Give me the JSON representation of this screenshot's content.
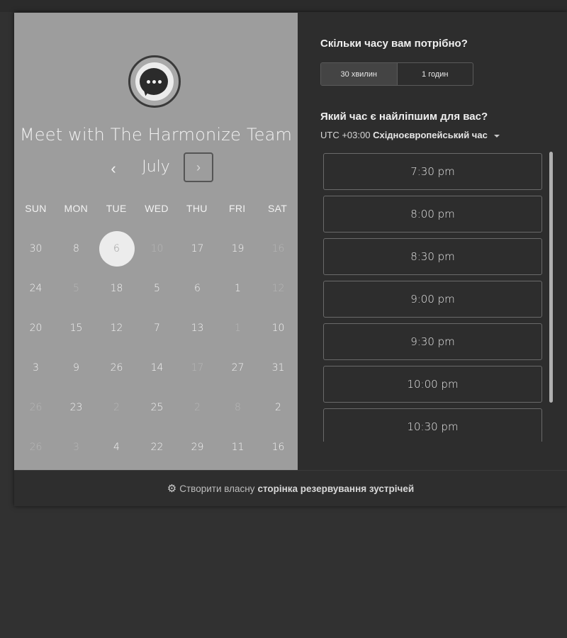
{
  "meeting": {
    "title": "Meet with The Harmonize Team",
    "logo_icon": "chat-bubble-icon"
  },
  "calendar": {
    "month": "July",
    "prev_icon": "‹",
    "next_icon": "›",
    "weekdays": [
      "SUN",
      "MON",
      "TUE",
      "WED",
      "THU",
      "FRI",
      "SAT"
    ],
    "rows": [
      [
        {
          "d": "30"
        },
        {
          "d": "8"
        },
        {
          "d": "6",
          "selected": true
        },
        {
          "d": "10",
          "dim": true
        },
        {
          "d": "17"
        },
        {
          "d": "19"
        },
        {
          "d": "16",
          "dim": true
        }
      ],
      [
        {
          "d": "24"
        },
        {
          "d": "5",
          "dim": true
        },
        {
          "d": "18"
        },
        {
          "d": "5"
        },
        {
          "d": "6"
        },
        {
          "d": "1"
        },
        {
          "d": "12",
          "dim": true
        }
      ],
      [
        {
          "d": "20"
        },
        {
          "d": "15"
        },
        {
          "d": "12"
        },
        {
          "d": "7"
        },
        {
          "d": "13"
        },
        {
          "d": "1",
          "dim": true
        },
        {
          "d": "10"
        }
      ],
      [
        {
          "d": "3"
        },
        {
          "d": "9"
        },
        {
          "d": "26"
        },
        {
          "d": "14"
        },
        {
          "d": "17",
          "dim": true
        },
        {
          "d": "27"
        },
        {
          "d": "31"
        }
      ],
      [
        {
          "d": "26",
          "dim": true
        },
        {
          "d": "23"
        },
        {
          "d": "2",
          "dim": true
        },
        {
          "d": "25"
        },
        {
          "d": "2",
          "dim": true
        },
        {
          "d": "8",
          "dim": true
        },
        {
          "d": "2"
        }
      ],
      [
        {
          "d": "26",
          "dim": true
        },
        {
          "d": "3",
          "dim": true
        },
        {
          "d": "4"
        },
        {
          "d": "22"
        },
        {
          "d": "29"
        },
        {
          "d": "11"
        },
        {
          "d": "16"
        }
      ]
    ]
  },
  "duration": {
    "question": "Скільки часу вам потрібно?",
    "options": [
      "30 хвилин",
      "1 годин"
    ],
    "selected": "30 хвилин"
  },
  "time": {
    "question": "Який час є найліпшим для вас?",
    "tz_offset": "UTC +03:00",
    "tz_name": "Східноєвропейський час",
    "slots": [
      "7:30 pm",
      "8:00 pm",
      "8:30 pm",
      "9:00 pm",
      "9:30 pm",
      "10:00 pm",
      "10:30 pm"
    ]
  },
  "footer": {
    "icon": "hubspot-sprocket-icon",
    "text": "Створити власну",
    "link": "сторінка резервування зустрічей"
  }
}
